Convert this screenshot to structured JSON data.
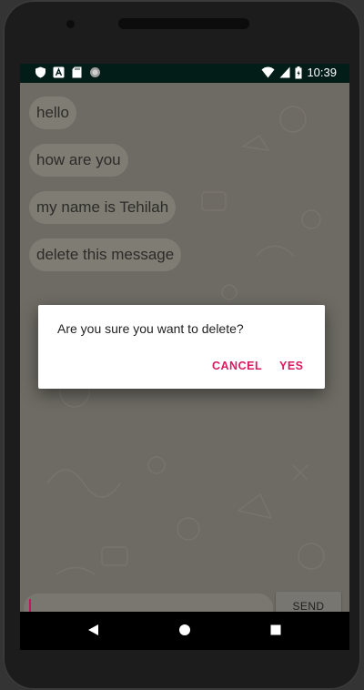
{
  "status_bar": {
    "time": "10:39",
    "left_icons": [
      "shield-icon",
      "app-a-icon",
      "sd-card-icon",
      "sync-icon"
    ],
    "right_icons": [
      "wifi-icon",
      "cell-signal-icon",
      "battery-icon"
    ]
  },
  "messages": [
    {
      "text": "hello"
    },
    {
      "text": "how are you"
    },
    {
      "text": "my name is Tehilah"
    },
    {
      "text": "delete this message"
    }
  ],
  "compose": {
    "input_value": "",
    "send_label": "SEND"
  },
  "dialog": {
    "message": "Are you sure you want to delete?",
    "cancel_label": "CANCEL",
    "yes_label": "YES"
  },
  "nav_bar": {
    "icons": [
      "back-icon",
      "home-icon",
      "recents-icon"
    ]
  },
  "colors": {
    "accent": "#d81b60",
    "status_bar": "#021d18",
    "chat_background": "#6e6b64"
  }
}
